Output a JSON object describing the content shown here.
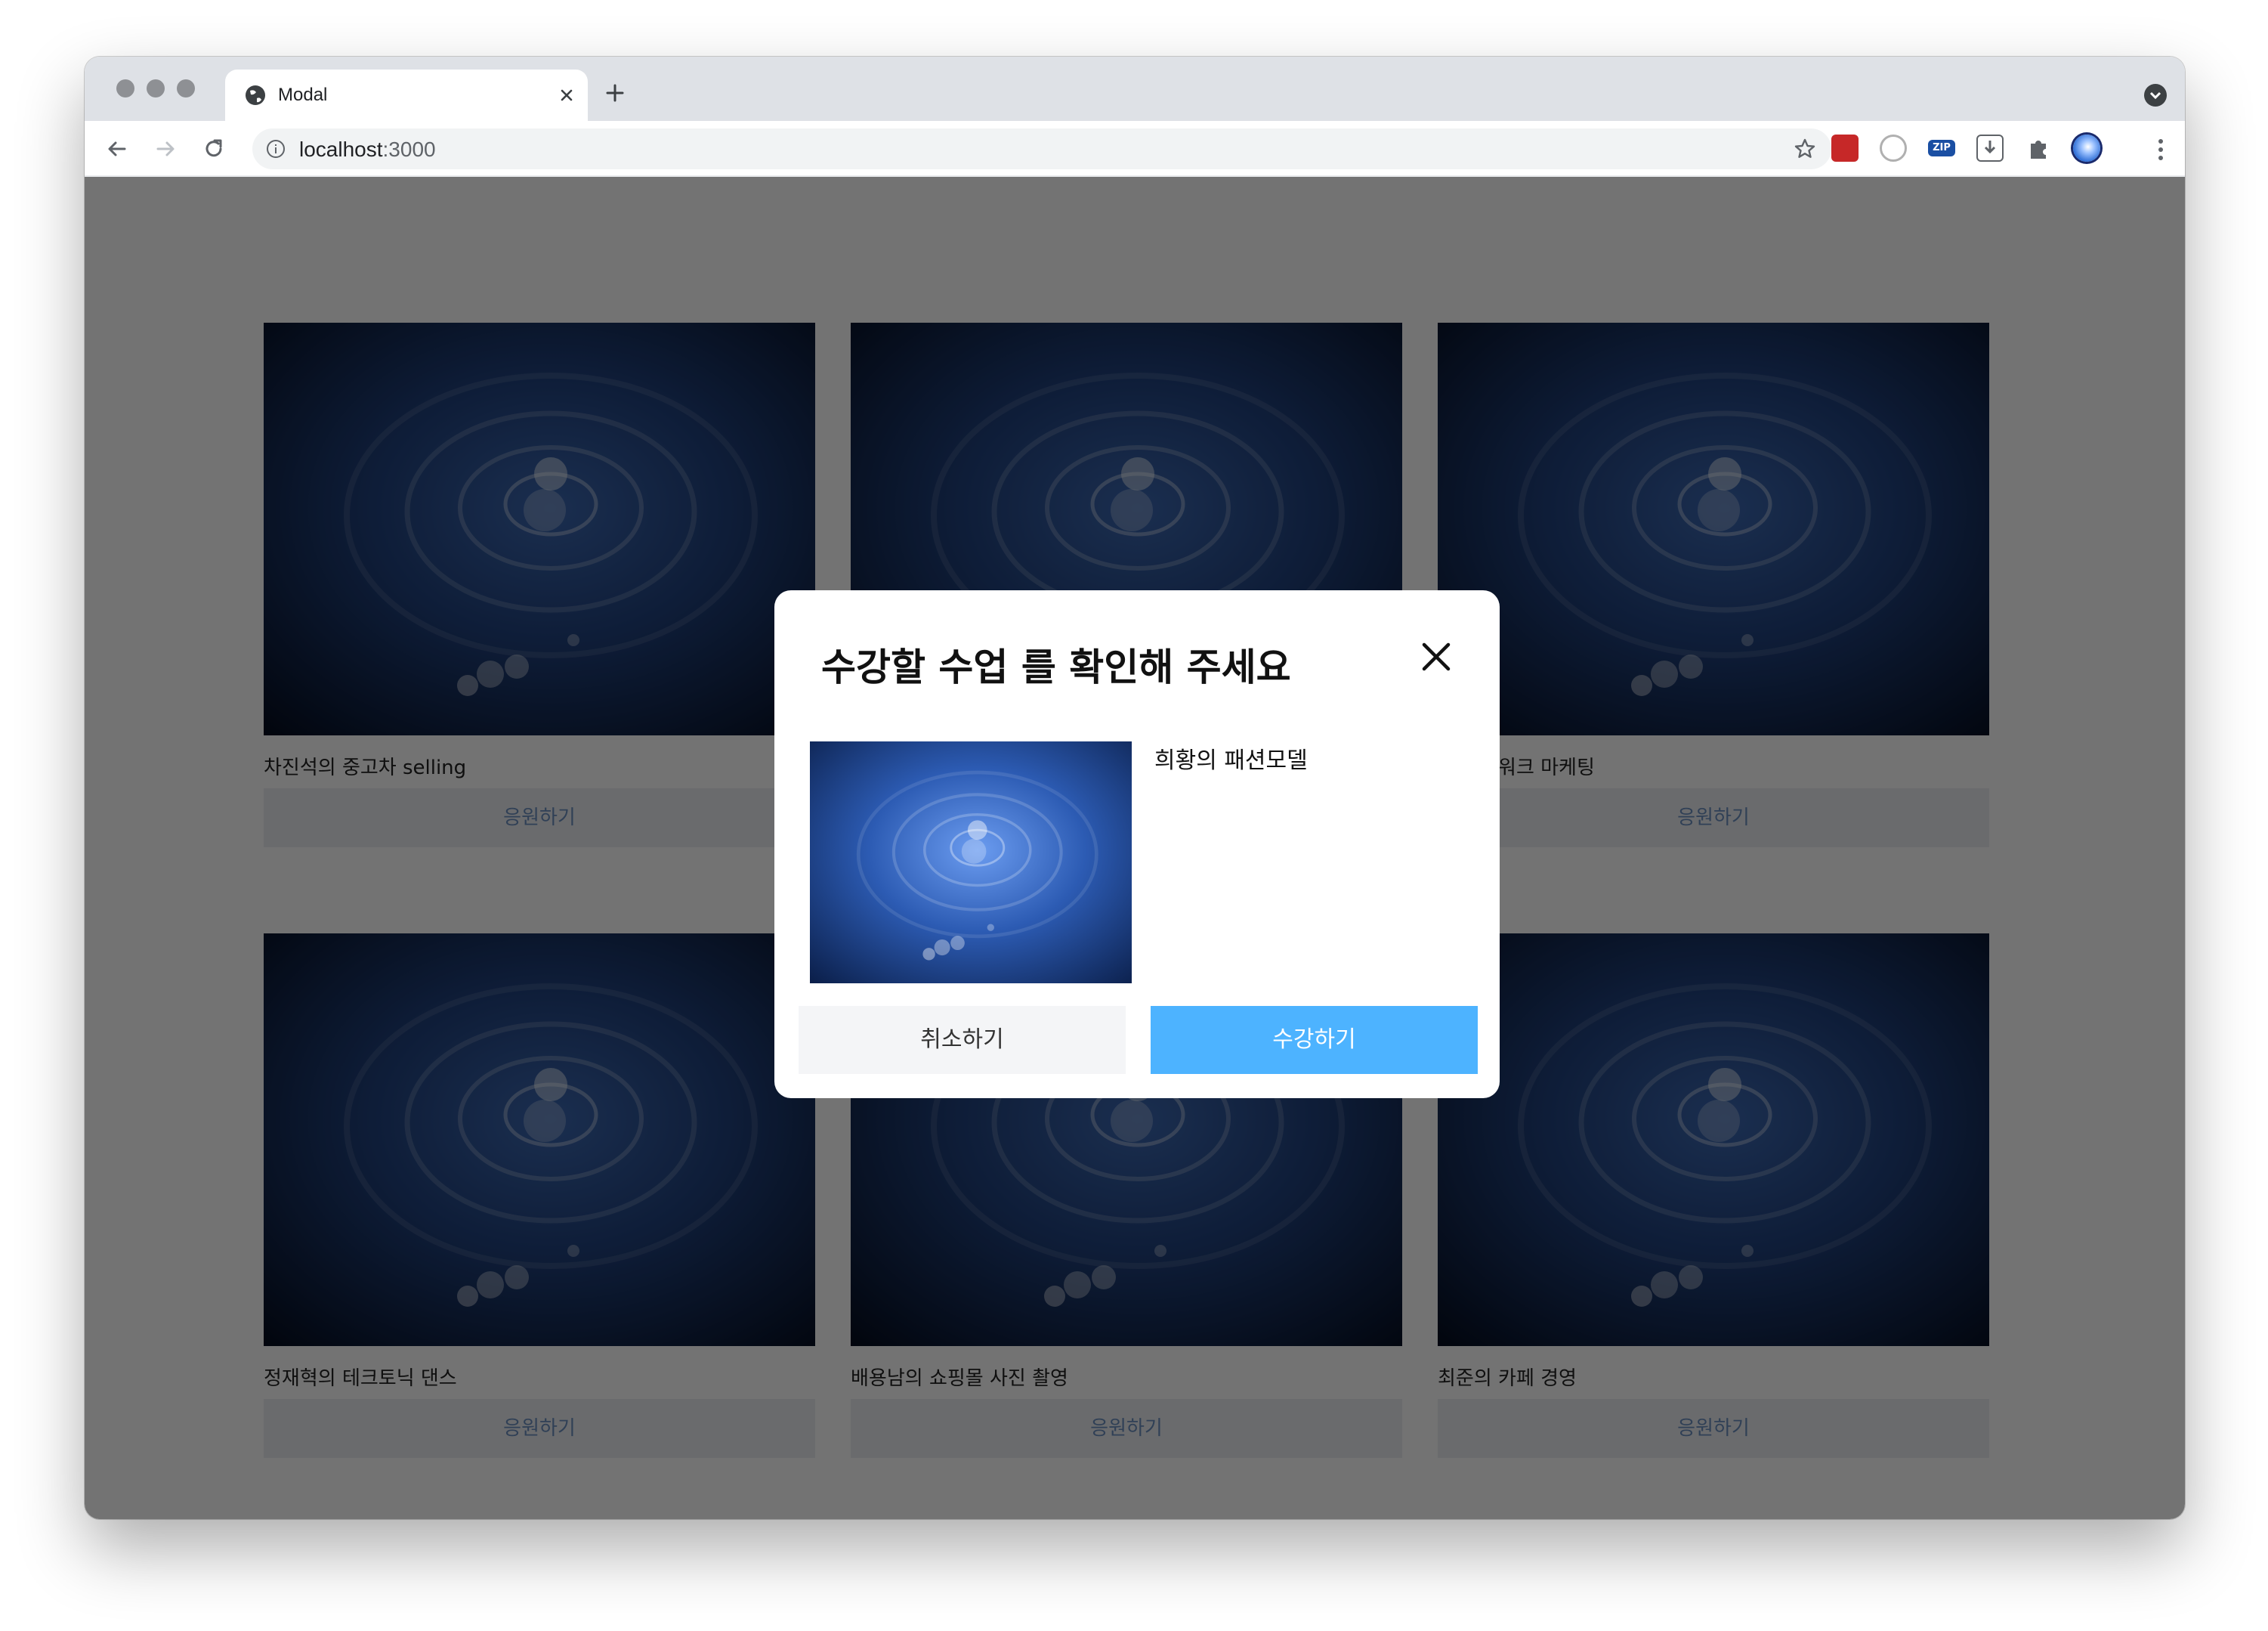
{
  "browser": {
    "tab_title": "Modal",
    "url_host": "localhost",
    "url_port": ":3000",
    "extensions": [
      {
        "name": "red-extension-icon",
        "color": "#c62828"
      },
      {
        "name": "target-extension-icon",
        "color": "#b0b0b0"
      },
      {
        "name": "zip-extension-icon",
        "color": "#1a4fa3",
        "label": "ZIP"
      },
      {
        "name": "download-extension-icon",
        "color": "#5f6368"
      },
      {
        "name": "puzzle-extension-icon",
        "color": "#5f6368"
      },
      {
        "name": "profile-avatar",
        "color": "#2f6fd6"
      }
    ]
  },
  "courses": [
    {
      "title": "차진석의 중고차 selling",
      "apply_label": "응원하기"
    },
    {
      "title": "",
      "apply_label": ""
    },
    {
      "title": "의 네트워크 마케팅",
      "apply_label": "응원하기"
    },
    {
      "title": "정재혁의 테크토닉 댄스",
      "apply_label": "응원하기"
    },
    {
      "title": "배용남의 쇼핑몰 사진 촬영",
      "apply_label": "응원하기"
    },
    {
      "title": "최준의 카페 경영",
      "apply_label": "응원하기"
    }
  ],
  "modal": {
    "title": "수강할 수업 를 확인해 주세요",
    "course_name": "희황의 패션모델",
    "cancel_label": "취소하기",
    "enroll_label": "수강하기"
  },
  "colors": {
    "overlay": "#000000",
    "enroll_button": "#4db3ff",
    "apply_button_text": "#6a8fbf"
  }
}
